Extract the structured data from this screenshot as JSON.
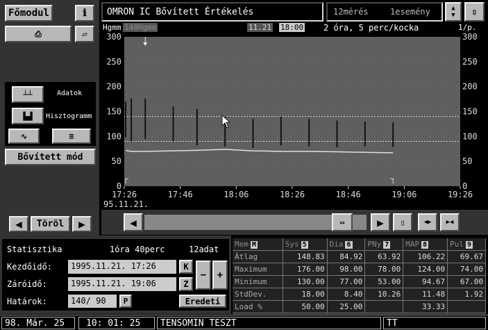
{
  "left": {
    "fomodul": "Főmodul",
    "adatok": "Adatok",
    "hisztogramm": "Hisztogramm",
    "bovitett_mod": "Bővített mód",
    "torol": "Töröl"
  },
  "header": {
    "title": "OMRON IC Bővített Értékelés",
    "meres": "12mérés",
    "esemeny": "1esemény"
  },
  "chart_header": {
    "unit": "Hgmm",
    "limit_label": "140Hgmm",
    "date": "11.21",
    "time": "18:00",
    "scale": "2 óra, 5 perc/kocka",
    "page": "1/p."
  },
  "chart_data": {
    "type": "line",
    "ylim": [
      0,
      300
    ],
    "yticks": [
      0,
      50,
      100,
      150,
      200,
      250,
      300
    ],
    "xticks": [
      "17:26",
      "17:46",
      "18:06",
      "18:26",
      "18:46",
      "19:06",
      "19:26"
    ],
    "date_label": "95.11.21.",
    "limits": [
      140,
      90
    ],
    "bars": [
      {
        "t": 0.5,
        "sys": 170,
        "dia": 98
      },
      {
        "t": 2.5,
        "sys": 176,
        "dia": 90
      },
      {
        "t": 7.5,
        "sys": 176,
        "dia": 95
      },
      {
        "t": 17.5,
        "sys": 160,
        "dia": 90
      },
      {
        "t": 26,
        "sys": 155,
        "dia": 82
      },
      {
        "t": 36,
        "sys": 140,
        "dia": 80
      },
      {
        "t": 46,
        "sys": 135,
        "dia": 77
      },
      {
        "t": 56,
        "sys": 140,
        "dia": 82
      },
      {
        "t": 66,
        "sys": 135,
        "dia": 80
      },
      {
        "t": 76,
        "sys": 132,
        "dia": 78
      },
      {
        "t": 86,
        "sys": 130,
        "dia": 80
      },
      {
        "t": 96,
        "sys": 128,
        "dia": 79
      }
    ],
    "pulse": [
      72,
      70,
      70,
      71,
      72,
      74,
      71,
      70,
      70,
      69,
      68,
      67
    ]
  },
  "stats": {
    "title": "Statisztika",
    "duration": "1óra 40perc",
    "count": "12adat",
    "kezdo_label": "Kezdőidő:",
    "kezdo_value": "1995.11.21. 17:26",
    "zaro_label": "Záróidő:",
    "zaro_value": "1995.11.21. 19:06",
    "hatar_label": "Határok:",
    "hatar_value": "140/ 90",
    "p_label": "P",
    "eredeti": "Eredeti",
    "k_label": "K",
    "z_label": "Z",
    "minus": "−",
    "plus": "+"
  },
  "table": {
    "headers": [
      {
        "label": "Mem",
        "key": "M"
      },
      {
        "label": "Sys",
        "key": "5"
      },
      {
        "label": "Dia",
        "key": "6"
      },
      {
        "label": "PNy",
        "key": "7"
      },
      {
        "label": "MAP",
        "key": "8"
      },
      {
        "label": "Pul",
        "key": "9"
      }
    ],
    "rows": [
      [
        "Átlag",
        "148.83",
        "84.92",
        "63.92",
        "106.22",
        "69.67"
      ],
      [
        "Maximum",
        "176.00",
        "98.00",
        "78.00",
        "124.00",
        "74.00"
      ],
      [
        "Minimum",
        "130.00",
        "77.00",
        "53.00",
        "94.67",
        "67.00"
      ],
      [
        "StdDev.",
        "18.00",
        "8.40",
        "10.26",
        "11.48",
        "1.92"
      ],
      [
        "Load %",
        "50.00",
        "25.00",
        "",
        "33.33",
        ""
      ]
    ]
  },
  "status": {
    "date": "98. Már. 25",
    "time": "10: 01: 25",
    "name": "TENSOMIN TESZT",
    "user": "TT"
  }
}
